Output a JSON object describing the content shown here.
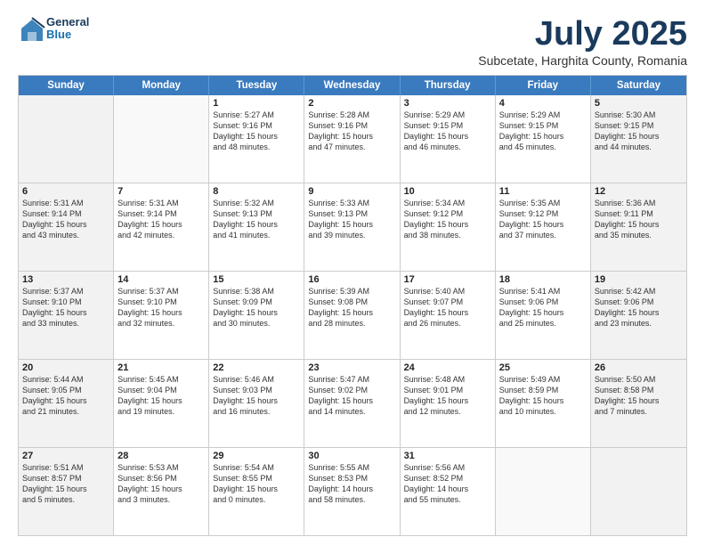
{
  "logo": {
    "general": "General",
    "blue": "Blue"
  },
  "title": {
    "month": "July 2025",
    "location": "Subcetate, Harghita County, Romania"
  },
  "header_days": [
    "Sunday",
    "Monday",
    "Tuesday",
    "Wednesday",
    "Thursday",
    "Friday",
    "Saturday"
  ],
  "weeks": [
    [
      {
        "day": "",
        "empty": true
      },
      {
        "day": "",
        "empty": true
      },
      {
        "day": "1",
        "lines": [
          "Sunrise: 5:27 AM",
          "Sunset: 9:16 PM",
          "Daylight: 15 hours",
          "and 48 minutes."
        ]
      },
      {
        "day": "2",
        "lines": [
          "Sunrise: 5:28 AM",
          "Sunset: 9:16 PM",
          "Daylight: 15 hours",
          "and 47 minutes."
        ]
      },
      {
        "day": "3",
        "lines": [
          "Sunrise: 5:29 AM",
          "Sunset: 9:15 PM",
          "Daylight: 15 hours",
          "and 46 minutes."
        ]
      },
      {
        "day": "4",
        "lines": [
          "Sunrise: 5:29 AM",
          "Sunset: 9:15 PM",
          "Daylight: 15 hours",
          "and 45 minutes."
        ]
      },
      {
        "day": "5",
        "lines": [
          "Sunrise: 5:30 AM",
          "Sunset: 9:15 PM",
          "Daylight: 15 hours",
          "and 44 minutes."
        ]
      }
    ],
    [
      {
        "day": "6",
        "lines": [
          "Sunrise: 5:31 AM",
          "Sunset: 9:14 PM",
          "Daylight: 15 hours",
          "and 43 minutes."
        ]
      },
      {
        "day": "7",
        "lines": [
          "Sunrise: 5:31 AM",
          "Sunset: 9:14 PM",
          "Daylight: 15 hours",
          "and 42 minutes."
        ]
      },
      {
        "day": "8",
        "lines": [
          "Sunrise: 5:32 AM",
          "Sunset: 9:13 PM",
          "Daylight: 15 hours",
          "and 41 minutes."
        ]
      },
      {
        "day": "9",
        "lines": [
          "Sunrise: 5:33 AM",
          "Sunset: 9:13 PM",
          "Daylight: 15 hours",
          "and 39 minutes."
        ]
      },
      {
        "day": "10",
        "lines": [
          "Sunrise: 5:34 AM",
          "Sunset: 9:12 PM",
          "Daylight: 15 hours",
          "and 38 minutes."
        ]
      },
      {
        "day": "11",
        "lines": [
          "Sunrise: 5:35 AM",
          "Sunset: 9:12 PM",
          "Daylight: 15 hours",
          "and 37 minutes."
        ]
      },
      {
        "day": "12",
        "lines": [
          "Sunrise: 5:36 AM",
          "Sunset: 9:11 PM",
          "Daylight: 15 hours",
          "and 35 minutes."
        ]
      }
    ],
    [
      {
        "day": "13",
        "lines": [
          "Sunrise: 5:37 AM",
          "Sunset: 9:10 PM",
          "Daylight: 15 hours",
          "and 33 minutes."
        ]
      },
      {
        "day": "14",
        "lines": [
          "Sunrise: 5:37 AM",
          "Sunset: 9:10 PM",
          "Daylight: 15 hours",
          "and 32 minutes."
        ]
      },
      {
        "day": "15",
        "lines": [
          "Sunrise: 5:38 AM",
          "Sunset: 9:09 PM",
          "Daylight: 15 hours",
          "and 30 minutes."
        ]
      },
      {
        "day": "16",
        "lines": [
          "Sunrise: 5:39 AM",
          "Sunset: 9:08 PM",
          "Daylight: 15 hours",
          "and 28 minutes."
        ]
      },
      {
        "day": "17",
        "lines": [
          "Sunrise: 5:40 AM",
          "Sunset: 9:07 PM",
          "Daylight: 15 hours",
          "and 26 minutes."
        ]
      },
      {
        "day": "18",
        "lines": [
          "Sunrise: 5:41 AM",
          "Sunset: 9:06 PM",
          "Daylight: 15 hours",
          "and 25 minutes."
        ]
      },
      {
        "day": "19",
        "lines": [
          "Sunrise: 5:42 AM",
          "Sunset: 9:06 PM",
          "Daylight: 15 hours",
          "and 23 minutes."
        ]
      }
    ],
    [
      {
        "day": "20",
        "lines": [
          "Sunrise: 5:44 AM",
          "Sunset: 9:05 PM",
          "Daylight: 15 hours",
          "and 21 minutes."
        ]
      },
      {
        "day": "21",
        "lines": [
          "Sunrise: 5:45 AM",
          "Sunset: 9:04 PM",
          "Daylight: 15 hours",
          "and 19 minutes."
        ]
      },
      {
        "day": "22",
        "lines": [
          "Sunrise: 5:46 AM",
          "Sunset: 9:03 PM",
          "Daylight: 15 hours",
          "and 16 minutes."
        ]
      },
      {
        "day": "23",
        "lines": [
          "Sunrise: 5:47 AM",
          "Sunset: 9:02 PM",
          "Daylight: 15 hours",
          "and 14 minutes."
        ]
      },
      {
        "day": "24",
        "lines": [
          "Sunrise: 5:48 AM",
          "Sunset: 9:01 PM",
          "Daylight: 15 hours",
          "and 12 minutes."
        ]
      },
      {
        "day": "25",
        "lines": [
          "Sunrise: 5:49 AM",
          "Sunset: 8:59 PM",
          "Daylight: 15 hours",
          "and 10 minutes."
        ]
      },
      {
        "day": "26",
        "lines": [
          "Sunrise: 5:50 AM",
          "Sunset: 8:58 PM",
          "Daylight: 15 hours",
          "and 7 minutes."
        ]
      }
    ],
    [
      {
        "day": "27",
        "lines": [
          "Sunrise: 5:51 AM",
          "Sunset: 8:57 PM",
          "Daylight: 15 hours",
          "and 5 minutes."
        ]
      },
      {
        "day": "28",
        "lines": [
          "Sunrise: 5:53 AM",
          "Sunset: 8:56 PM",
          "Daylight: 15 hours",
          "and 3 minutes."
        ]
      },
      {
        "day": "29",
        "lines": [
          "Sunrise: 5:54 AM",
          "Sunset: 8:55 PM",
          "Daylight: 15 hours",
          "and 0 minutes."
        ]
      },
      {
        "day": "30",
        "lines": [
          "Sunrise: 5:55 AM",
          "Sunset: 8:53 PM",
          "Daylight: 14 hours",
          "and 58 minutes."
        ]
      },
      {
        "day": "31",
        "lines": [
          "Sunrise: 5:56 AM",
          "Sunset: 8:52 PM",
          "Daylight: 14 hours",
          "and 55 minutes."
        ]
      },
      {
        "day": "",
        "empty": true
      },
      {
        "day": "",
        "empty": true
      }
    ]
  ]
}
